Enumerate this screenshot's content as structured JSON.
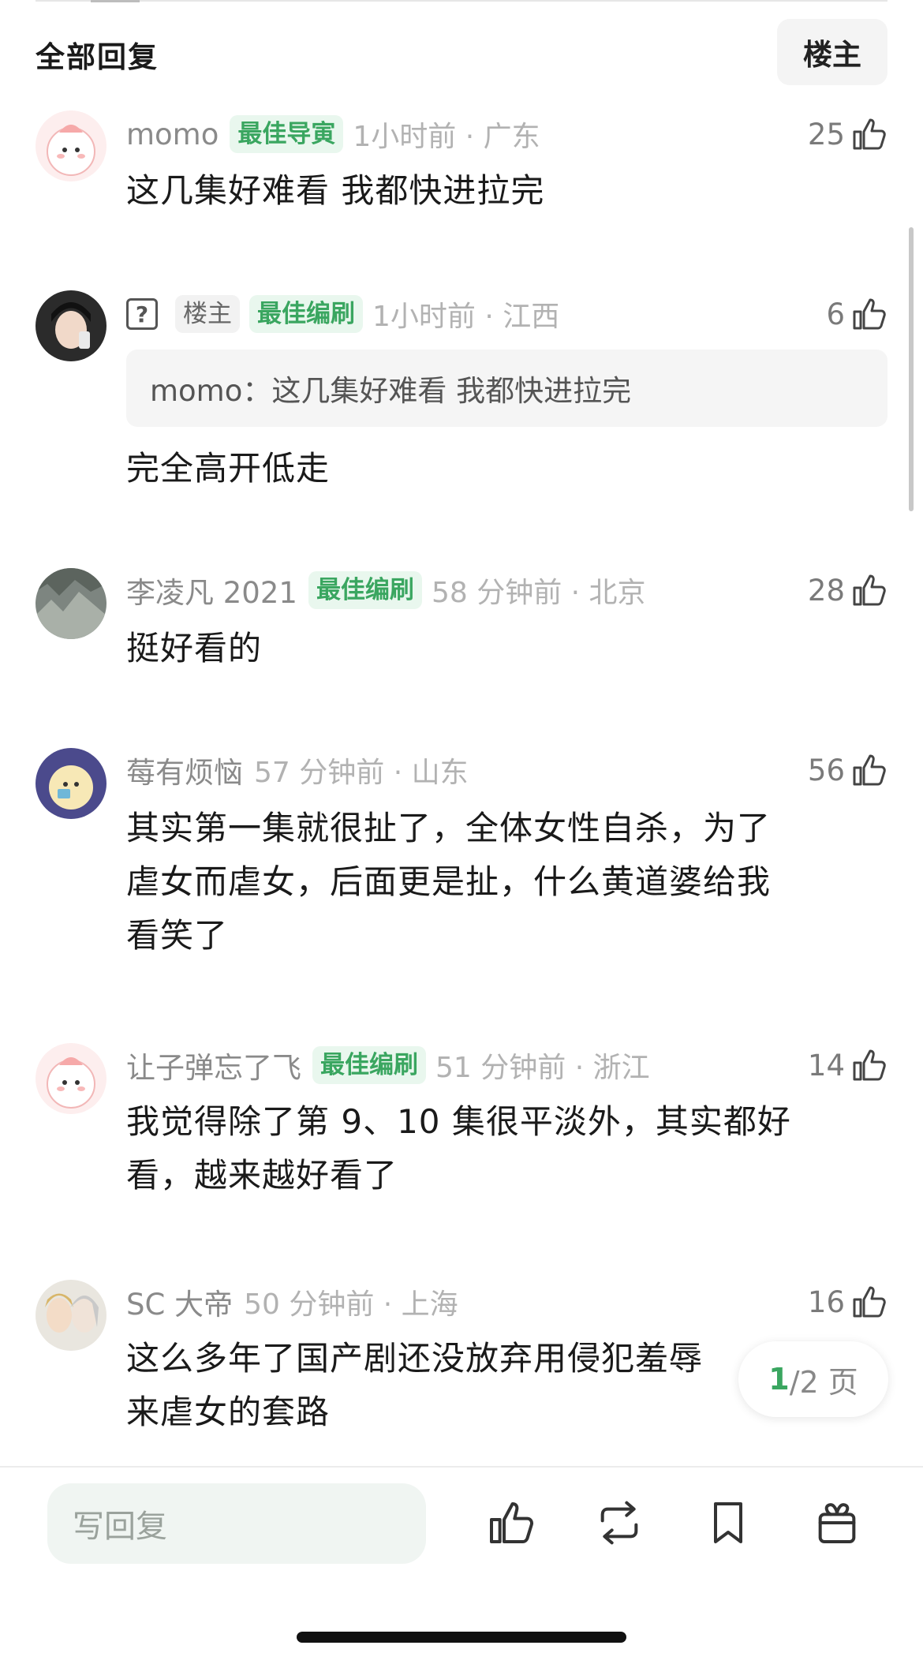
{
  "header": {
    "title": "全部回复",
    "op_button": "楼主"
  },
  "comments": [
    {
      "username": "momo",
      "badges": [
        "最佳导寅"
      ],
      "time_location": "1小时前 · 广东",
      "likes": "25",
      "text": "这几集好难看 我都快进拉完"
    },
    {
      "username": "",
      "badges": [
        "楼主",
        "最佳编刷"
      ],
      "time_location": "1小时前 · 江西",
      "likes": "6",
      "quote": "momo：这几集好难看 我都快进拉完",
      "text": "完全高开低走"
    },
    {
      "username": "李凌凡 2021",
      "badges": [
        "最佳编刷"
      ],
      "time_location": "58 分钟前 · 北京",
      "likes": "28",
      "text": "挺好看的"
    },
    {
      "username": "莓有烦恼",
      "badges": [],
      "time_location": "57 分钟前 · 山东",
      "likes": "56",
      "text_lines": [
        "其实第一集就很扯了，全体女性自杀，为了",
        "虐女而虐女，后面更是扯，什么黄道婆给我",
        "看笑了"
      ]
    },
    {
      "username": "让子弹忘了飞",
      "badges": [
        "最佳编刷"
      ],
      "time_location": "51 分钟前 · 浙江",
      "likes": "14",
      "text_lines": [
        "我觉得除了第 9、10 集很平淡外，其实都好",
        "看，越来越好看了"
      ]
    },
    {
      "username": "SC 大帝",
      "badges": [],
      "time_location": "50 分钟前 · 上海",
      "likes": "16",
      "text_lines": [
        "这么多年了国产剧还没放弃用侵犯羞辱",
        "来虐女的套路"
      ]
    }
  ],
  "pager": {
    "current": "1",
    "total": "/2 页"
  },
  "bottom_bar": {
    "reply_placeholder": "写回复",
    "icons": [
      "like-icon",
      "repost-icon",
      "bookmark-icon",
      "gift-icon"
    ]
  },
  "colors": {
    "accent_green": "#3aa660",
    "badge_bg": "#e9f7ee"
  }
}
